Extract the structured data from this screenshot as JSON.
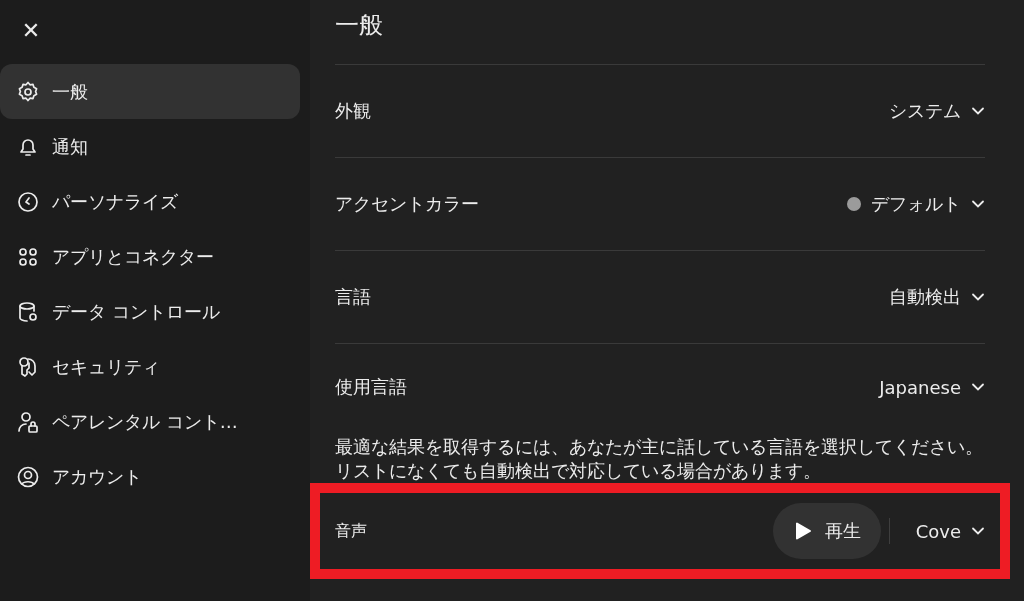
{
  "sidebar": {
    "close_label": "✕",
    "items": [
      {
        "label": "一般",
        "selected": true
      },
      {
        "label": "通知",
        "selected": false
      },
      {
        "label": "パーソナライズ",
        "selected": false
      },
      {
        "label": "アプリとコネクター",
        "selected": false
      },
      {
        "label": "データ コントロール",
        "selected": false
      },
      {
        "label": "セキュリティ",
        "selected": false
      },
      {
        "label": "ペアレンタル コント…",
        "selected": false
      },
      {
        "label": "アカウント",
        "selected": false
      }
    ]
  },
  "main": {
    "title": "一般",
    "rows": [
      {
        "kind": "dropdown",
        "label": "外観",
        "value": "システム"
      },
      {
        "kind": "color-dropdown",
        "label": "アクセントカラー",
        "value": "デフォルト"
      },
      {
        "kind": "dropdown",
        "label": "言語",
        "value": "自動検出"
      },
      {
        "kind": "dropdown",
        "label": "使用言語",
        "value": "Japanese",
        "help": "最適な結果を取得するには、あなたが主に話している言語を選択してください。リストになくても自動検出で対応している場合があります。"
      },
      {
        "kind": "voice",
        "label": "音声",
        "play_label": "再生",
        "value": "Cove",
        "highlighted": true
      }
    ]
  }
}
